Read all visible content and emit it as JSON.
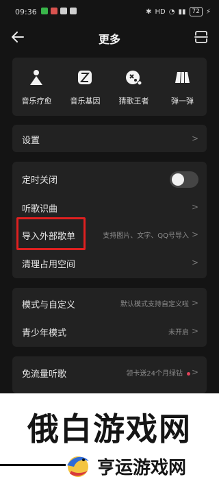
{
  "status_bar": {
    "time": "09:36",
    "hd": "HD",
    "battery": "72"
  },
  "header": {
    "title": "更多"
  },
  "apps": [
    {
      "label": "音乐疗愈",
      "icon": "music-therapy-icon"
    },
    {
      "label": "音乐基因",
      "icon": "music-gene-icon"
    },
    {
      "label": "猜歌王者",
      "icon": "guess-song-icon"
    },
    {
      "label": "弹一弹",
      "icon": "piano-keys-icon"
    }
  ],
  "settings": {
    "label": "设置"
  },
  "tools": {
    "timer": {
      "label": "定时关闭",
      "enabled": false
    },
    "recognize": {
      "label": "听歌识曲"
    },
    "import": {
      "label": "导入外部歌单",
      "sub": "支持图片、文字、QQ号导入"
    },
    "clean": {
      "label": "清理占用空间"
    }
  },
  "modes": {
    "mode": {
      "label": "模式与自定义",
      "sub": "默认模式支持自定义啦"
    },
    "teen": {
      "label": "青少年模式",
      "sub": "未开启"
    }
  },
  "free_traffic": {
    "label": "免流量听歌",
    "sub": "领卡送24个月绿钻"
  },
  "watermark": {
    "main": "俄白游戏网",
    "sub": "亨运游戏网"
  }
}
